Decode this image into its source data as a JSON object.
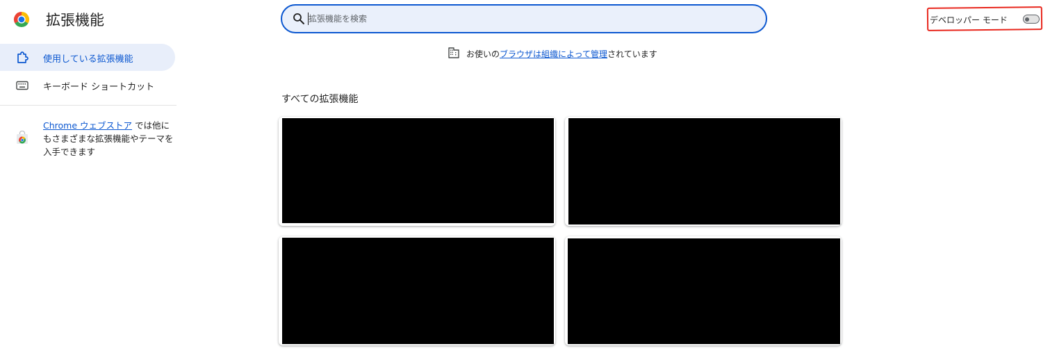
{
  "header": {
    "title": "拡張機能",
    "logo_icon": "chrome-logo-icon"
  },
  "search": {
    "placeholder": "拡張機能を検索",
    "value": "",
    "icon": "search-icon"
  },
  "developer_mode": {
    "label": "デベロッパー モード",
    "enabled": false,
    "highlight_color": "#e8261c"
  },
  "sidebar": {
    "items": [
      {
        "label": "使用している拡張機能",
        "icon": "puzzle-icon",
        "selected": true
      },
      {
        "label": "キーボード ショートカット",
        "icon": "keyboard-icon",
        "selected": false
      }
    ],
    "webstore": {
      "icon": "chrome-web-store-icon",
      "link_text": "Chrome ウェブストア",
      "text_after_link": " では他にもさまざまな拡張機能やテーマを入手できます"
    }
  },
  "managed_notice": {
    "icon": "building-icon",
    "prefix": "お使いの",
    "link_text": "ブラウザは組織によって管理",
    "suffix": "されています"
  },
  "main": {
    "section_heading": "すべての拡張機能",
    "extension_cards": [
      {
        "redacted": true
      },
      {
        "redacted": true
      },
      {
        "redacted": true
      },
      {
        "redacted": true
      }
    ]
  },
  "colors": {
    "accent": "#0b57d0",
    "selected_nav_bg": "#e8eefa",
    "search_bg": "#eaf0fb"
  }
}
